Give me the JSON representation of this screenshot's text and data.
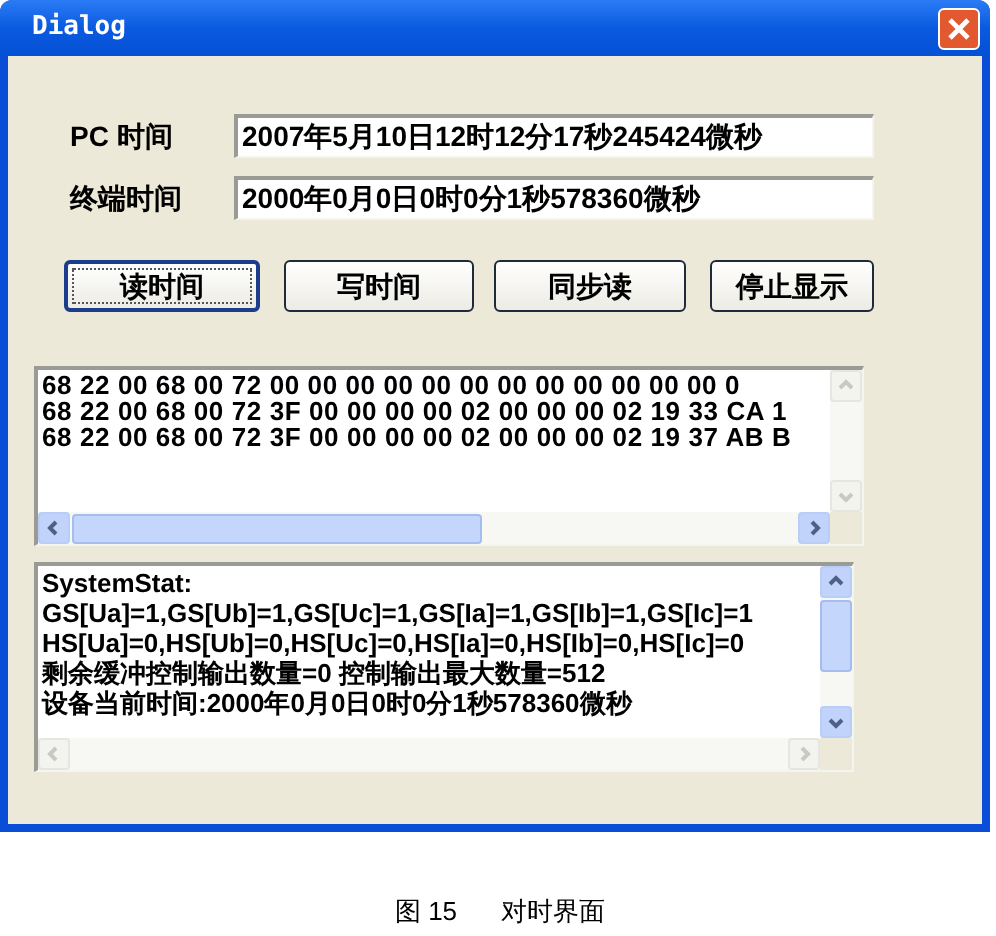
{
  "window": {
    "title": "Dialog"
  },
  "fields": [
    {
      "label": "PC 时间",
      "value": "2007年5月10日12时12分17秒245424微秒"
    },
    {
      "label": "终端时间",
      "value": "2000年0月0日0时0分1秒578360微秒"
    }
  ],
  "buttons": [
    {
      "label": "读时间",
      "focused": true
    },
    {
      "label": "写时间",
      "focused": false
    },
    {
      "label": "同步读",
      "focused": false
    },
    {
      "label": "停止显示",
      "focused": false
    }
  ],
  "hex_log": {
    "lines": [
      "68 22 00 68 00 72 00 00 00 00 00 00 00 00 00 00 00 00 0",
      "68 22 00 68 00 72 3F 00 00 00 00 02 00 00 00 02 19 33 CA 1",
      "68 22 00 68 00 72 3F 00 00 00 00 02 00 00 00 02 19 37 AB B"
    ]
  },
  "status_log": {
    "lines": [
      "SystemStat:",
      "GS[Ua]=1,GS[Ub]=1,GS[Uc]=1,GS[Ia]=1,GS[Ib]=1,GS[Ic]=1",
      "HS[Ua]=0,HS[Ub]=0,HS[Uc]=0,HS[Ia]=0,HS[Ib]=0,HS[Ic]=0",
      "剩余缓冲控制输出数量=0 控制输出最大数量=512",
      "设备当前时间:2000年0月0日0时0分1秒578360微秒"
    ]
  },
  "figure": {
    "number": "图 15",
    "caption": "对时界面"
  }
}
